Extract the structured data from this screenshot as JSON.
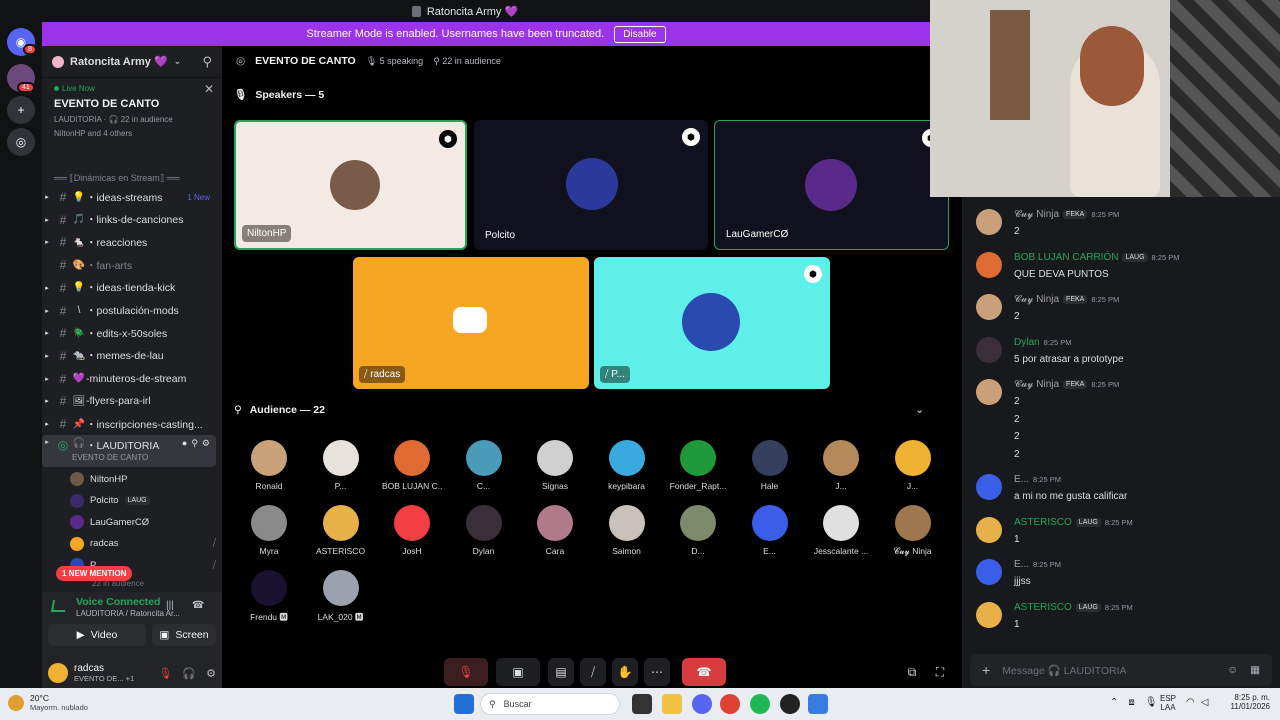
{
  "title_bar": {
    "title": "Ratoncita Army 💜"
  },
  "banner": {
    "text": "Streamer Mode is enabled. Usernames have been truncated.",
    "button": "Disable"
  },
  "server_rail": {
    "dm_badge": "8",
    "server_badge": "41"
  },
  "server": {
    "name": "Ratoncita Army 💜"
  },
  "live_card": {
    "live_label": "Live Now",
    "event": "EVENTO DE CANTO",
    "channel_line": "LAUDITORIA · 🎧 22 in audience",
    "members_line": "NiltonHP and 4 others"
  },
  "category": {
    "label": "══ ⟦Dinámicas en Stream⟧ ══"
  },
  "channels": [
    {
      "name": "・ideas-streams",
      "emoji": "💡",
      "badge": "1 New"
    },
    {
      "name": "・links-de-canciones",
      "emoji": "🎵"
    },
    {
      "name": "・reacciones",
      "emoji": "🐁"
    },
    {
      "name": "・fan-arts",
      "emoji": "🎨"
    },
    {
      "name": "・ideas-tienda-kick",
      "emoji": "💡"
    },
    {
      "name": "・postulación-mods",
      "emoji": "\\"
    },
    {
      "name": "・edits-x-50soles",
      "emoji": "🪲"
    },
    {
      "name": "・memes-de-lau",
      "emoji": "🐀"
    },
    {
      "name": "-minuteros-de-stream",
      "emoji": "💜"
    },
    {
      "name": "-flyers-para-irl",
      "emoji": "🖼"
    },
    {
      "name": "・inscripciones-casting...",
      "emoji": "📌"
    }
  ],
  "voice_channel": {
    "name": "・LAUDITORIA",
    "sub": "EVENTO DE CANTO"
  },
  "voice_users": [
    {
      "name": "NiltonHP",
      "tag": ""
    },
    {
      "name": "Polcito",
      "tag": "LAUG"
    },
    {
      "name": "LauGamerCØ",
      "tag": ""
    },
    {
      "name": "radcas",
      "tag": ""
    },
    {
      "name": "P",
      "tag": ""
    }
  ],
  "voice_more": "22 in audience",
  "mention_pill": "1 NEW MENTION",
  "voice_connected": {
    "status": "Voice Connected",
    "location": "LAUDITORIA / Ratoncita Ar...",
    "video": "Video",
    "screen": "Screen"
  },
  "user_panel": {
    "name": "radcas",
    "status": "EVENTO DE...",
    "extra": "+1"
  },
  "stage": {
    "title": "EVENTO DE CANTO",
    "speaking": "5 speaking",
    "audience": "22 in audience",
    "speakers_label": "Speakers — 5",
    "audience_label": "Audience — 22"
  },
  "speakers": [
    {
      "name": "NiltonHP"
    },
    {
      "name": "Polcito"
    },
    {
      "name": "LauGamerCØ"
    },
    {
      "name": "radcas"
    },
    {
      "name": "P..."
    }
  ],
  "audience": [
    {
      "name": "Ronald",
      "color": "#c9a27a"
    },
    {
      "name": "P...",
      "color": "#e8e2dc"
    },
    {
      "name": "BOB LUJAN C...",
      "color": "#e06b32"
    },
    {
      "name": "C...",
      "color": "#4a9bb8"
    },
    {
      "name": "Signas",
      "color": "#d0d0d0"
    },
    {
      "name": "keypibara",
      "color": "#39a9e0"
    },
    {
      "name": "Fonder_Rapt...",
      "color": "#1e9a3a"
    },
    {
      "name": "Hale",
      "color": "#34405e"
    },
    {
      "name": "J...",
      "color": "#b58a5a"
    },
    {
      "name": "J...",
      "color": "#f0b232"
    },
    {
      "name": "Myra",
      "color": "#8a8a8a"
    },
    {
      "name": "ASTERISCO",
      "color": "#e8b048"
    },
    {
      "name": "JosH",
      "color": "#f23f43"
    },
    {
      "name": "Dylan",
      "color": "#3a2e38"
    },
    {
      "name": "Cara",
      "color": "#b07a8a"
    },
    {
      "name": "Saimon",
      "color": "#c9c2bb"
    },
    {
      "name": "D...",
      "color": "#7d8a6b"
    },
    {
      "name": "E...",
      "color": "#3a5ee8"
    },
    {
      "name": "Jesscalante ...",
      "color": "#e0e0e0"
    },
    {
      "name": "𝓒𝓾𝔂 Ninja",
      "color": "#a07850"
    },
    {
      "name": "Frendu 🅼",
      "color": "#1a1030"
    },
    {
      "name": "LAK_020 🅼",
      "color": "#9aa3ad"
    }
  ],
  "chat": [
    {
      "name": "𝓒𝓾𝔂 Ninja",
      "badge": "FEKA",
      "time": "8:25 PM",
      "lines": [
        "2"
      ],
      "color": "#a0a0a0"
    },
    {
      "name": "BOB LUJAN CARRIÓN",
      "badge": "LAUG",
      "time": "8:25 PM",
      "lines": [
        "QUE DEVA PUNTOS"
      ],
      "color": "#23a55a"
    },
    {
      "name": "𝓒𝓾𝔂 Ninja",
      "badge": "FEKA",
      "time": "8:25 PM",
      "lines": [
        "2"
      ],
      "color": "#a0a0a0"
    },
    {
      "name": "Dylan",
      "badge": "",
      "time": "8:25 PM",
      "lines": [
        "5 por atrasar a prototype"
      ],
      "color": "#23a55a"
    },
    {
      "name": "𝓒𝓾𝔂 Ninja",
      "badge": "FEKA",
      "time": "8:25 PM",
      "lines": [
        "2",
        "2",
        "2",
        "2"
      ],
      "color": "#a0a0a0"
    },
    {
      "name": "E...",
      "badge": "",
      "time": "8:25 PM",
      "lines": [
        "a mi no me gusta calificar"
      ],
      "color": "#a0a0a0"
    },
    {
      "name": "ASTERISCO",
      "badge": "LAUG",
      "time": "8:25 PM",
      "lines": [
        "1"
      ],
      "color": "#23a55a"
    },
    {
      "name": "E...",
      "badge": "",
      "time": "8:25 PM",
      "lines": [
        "jjjss"
      ],
      "color": "#a0a0a0"
    },
    {
      "name": "ASTERISCO",
      "badge": "LAUG",
      "time": "8:25 PM",
      "lines": [
        "1"
      ],
      "color": "#23a55a"
    }
  ],
  "chat_input": {
    "placeholder": "Message 🎧 LAUDITORIA"
  },
  "taskbar": {
    "temp": "20°C",
    "weather": "Mayorm. nublado",
    "search": "Buscar",
    "lang": "ESP",
    "lang2": "LAA",
    "time": "8:25 p. m.",
    "date": "11/01/2026"
  }
}
